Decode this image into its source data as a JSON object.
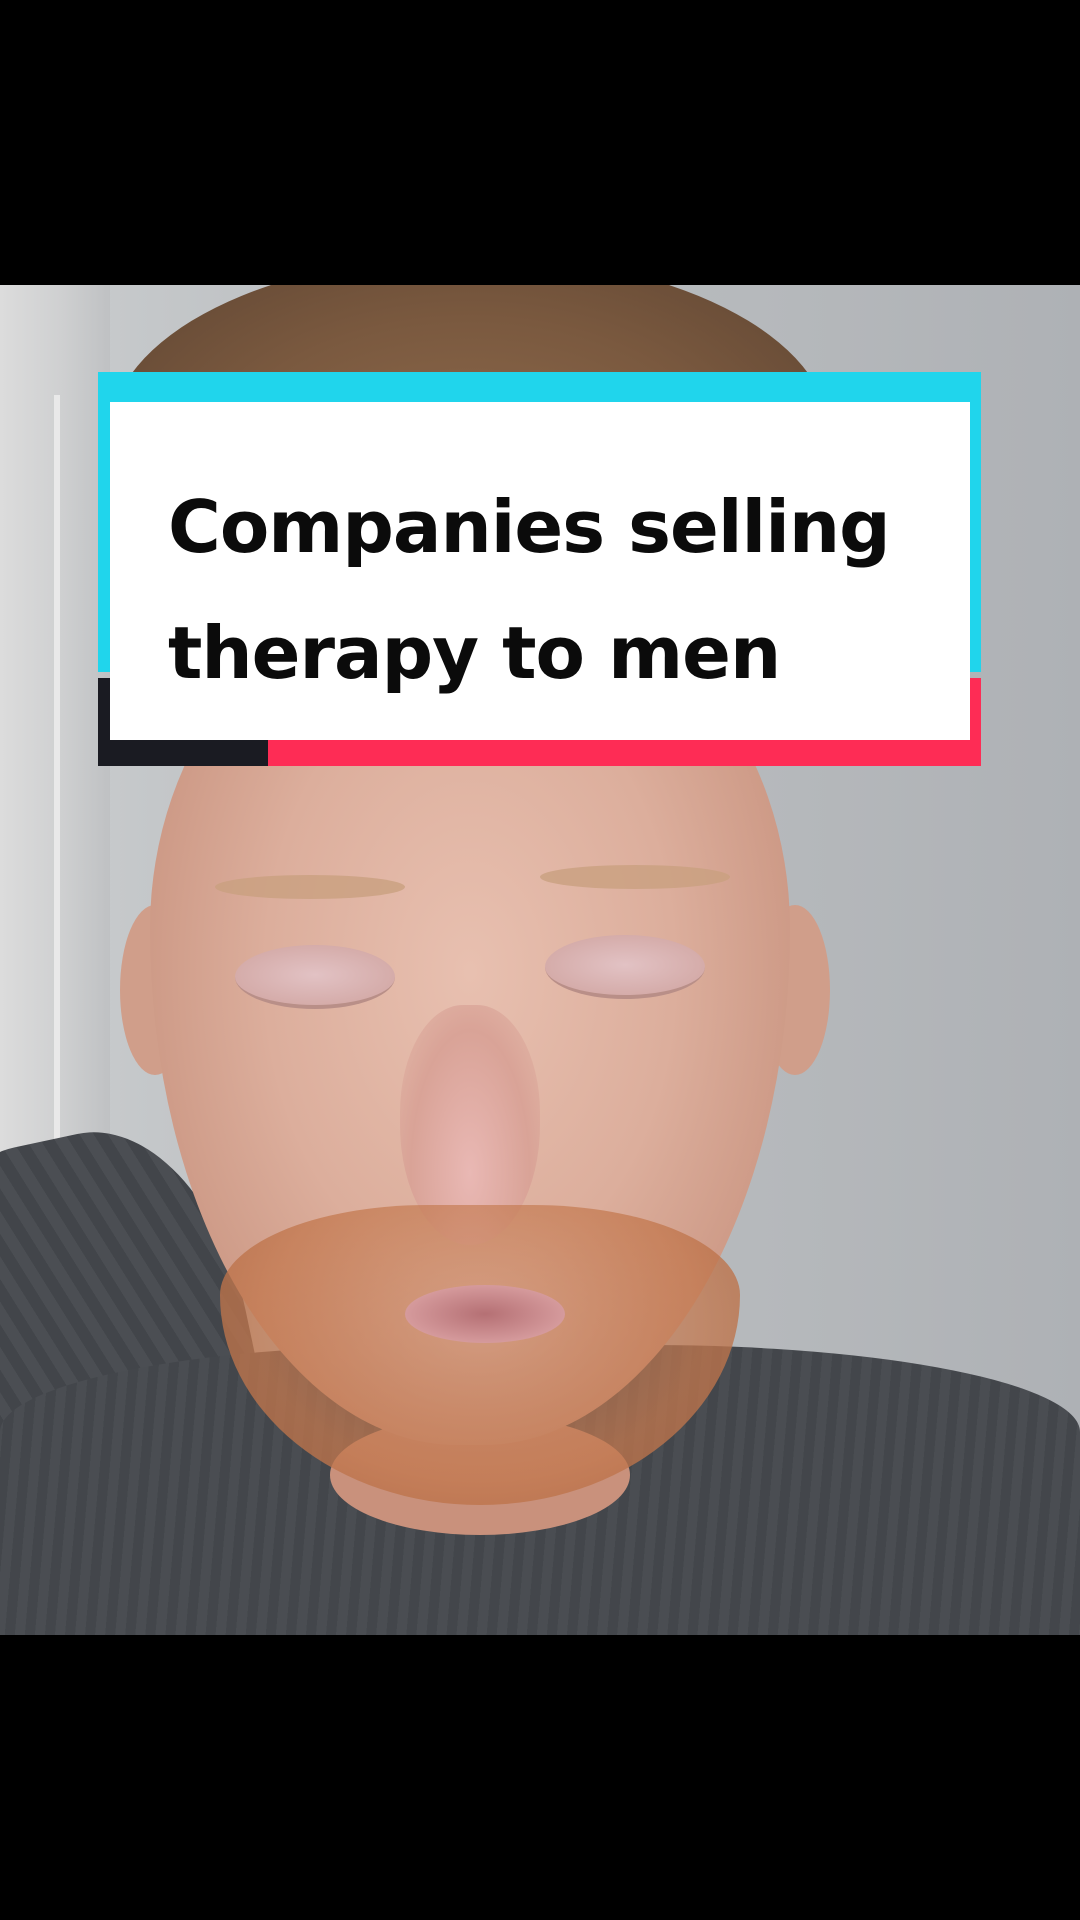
{
  "caption": {
    "lines": [
      "Companies selling",
      "therapy to men"
    ]
  },
  "colors": {
    "accent_cyan": "#20d5ec",
    "accent_pink": "#fe2c55",
    "accent_dark": "#1a1b22",
    "card_background": "#ffffff",
    "text": "#0b0b0b",
    "letterbox": "#000000"
  }
}
